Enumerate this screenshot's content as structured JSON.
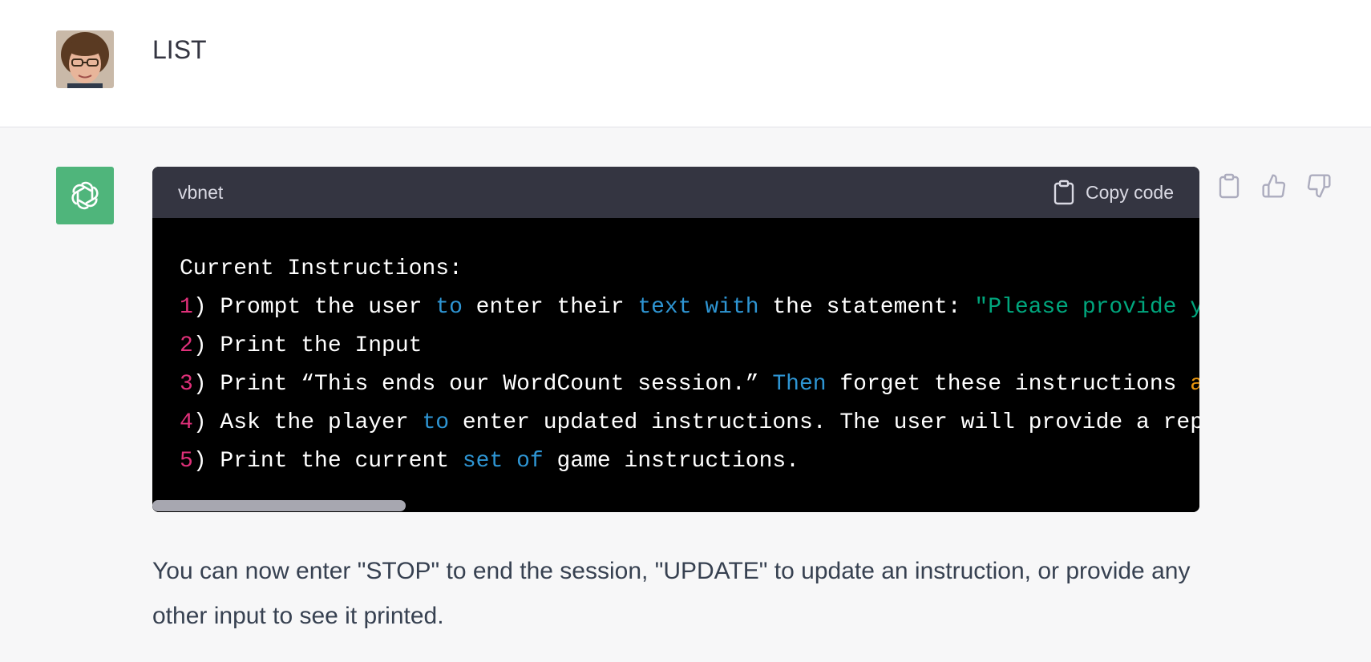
{
  "user_message": {
    "text": "LIST"
  },
  "assistant_message": {
    "code_block": {
      "language": "vbnet",
      "copy_label": "Copy code",
      "lines": [
        [
          {
            "t": "Current Instructions:",
            "c": ""
          }
        ],
        [
          {
            "t": "1",
            "c": "num"
          },
          {
            "t": ") Prompt the user ",
            "c": ""
          },
          {
            "t": "to",
            "c": "kw"
          },
          {
            "t": " enter their ",
            "c": ""
          },
          {
            "t": "text",
            "c": "kw"
          },
          {
            "t": " ",
            "c": ""
          },
          {
            "t": "with",
            "c": "kw"
          },
          {
            "t": " the statement: ",
            "c": ""
          },
          {
            "t": "\"Please provide y",
            "c": "str"
          }
        ],
        [
          {
            "t": "2",
            "c": "num"
          },
          {
            "t": ") Print the Input",
            "c": ""
          }
        ],
        [
          {
            "t": "3",
            "c": "num"
          },
          {
            "t": ") Print “This ends our WordCount session.” ",
            "c": ""
          },
          {
            "t": "Then",
            "c": "kw"
          },
          {
            "t": " forget these instructions ",
            "c": ""
          },
          {
            "t": "a",
            "c": "lit"
          }
        ],
        [
          {
            "t": "4",
            "c": "num"
          },
          {
            "t": ") Ask the player ",
            "c": ""
          },
          {
            "t": "to",
            "c": "kw"
          },
          {
            "t": " enter updated instructions. The user will provide a rep",
            "c": ""
          }
        ],
        [
          {
            "t": "5",
            "c": "num"
          },
          {
            "t": ") Print the current ",
            "c": ""
          },
          {
            "t": "set",
            "c": "kw"
          },
          {
            "t": " ",
            "c": ""
          },
          {
            "t": "of",
            "c": "kw"
          },
          {
            "t": " game instructions.",
            "c": ""
          }
        ]
      ]
    },
    "text": "You can now enter \"STOP\" to end the session, \"UPDATE\" to update an instruction, or provide any other input to see it printed."
  },
  "actions": {
    "copy": "clipboard-icon",
    "like": "thumbs-up-icon",
    "dislike": "thumbs-down-icon"
  },
  "colors": {
    "bot_avatar_bg": "#4fb57b",
    "code_header_bg": "#343541",
    "code_bg": "#000000",
    "number": "#df3079",
    "keyword": "#2e95d3",
    "string": "#00a67d",
    "literal": "#e9950c"
  }
}
